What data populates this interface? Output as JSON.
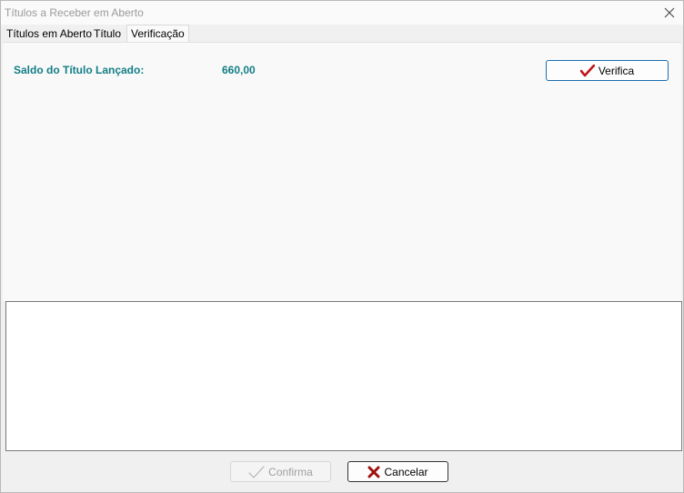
{
  "window": {
    "title": "Títulos a Receber em Aberto"
  },
  "tabs": [
    {
      "label": "Títulos em Aberto",
      "active": false
    },
    {
      "label": "Título",
      "active": false
    },
    {
      "label": "Verificação",
      "active": true
    }
  ],
  "verification": {
    "saldo_label": "Saldo do Título Lançado:",
    "saldo_value": "660,00",
    "verifica_label": "Verifica"
  },
  "edit_line": {
    "value": ""
  },
  "memo": {
    "value": ""
  },
  "footer": {
    "confirma_label": "Confirma",
    "cancelar_label": "Cancelar"
  },
  "colors": {
    "label_teal": "#137e86",
    "check_red": "#c0141c",
    "cancel_red": "#a01010"
  },
  "icons": {
    "close": "close-icon",
    "verifica": "check-icon",
    "confirma": "check-icon",
    "cancelar": "x-icon"
  }
}
